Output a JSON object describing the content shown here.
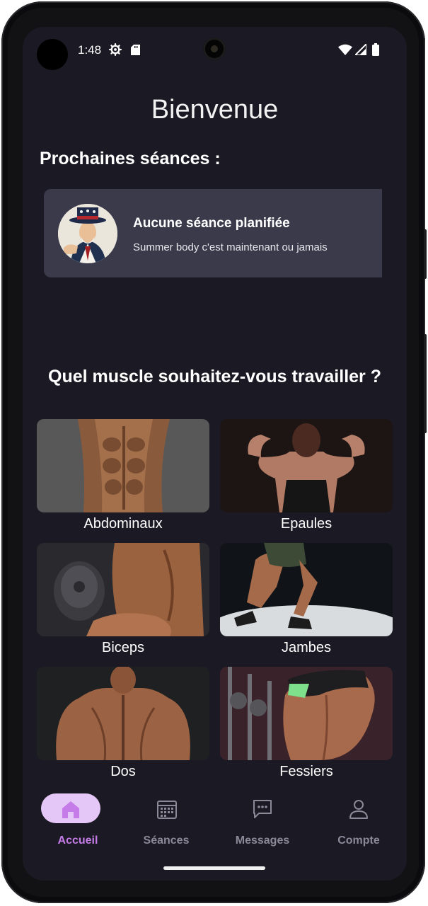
{
  "status_bar": {
    "time": "1:48"
  },
  "page_title": "Bienvenue",
  "upcoming": {
    "section_title": "Prochaines séances :",
    "card": {
      "title": "Aucune séance planifiée",
      "subtitle": "Summer body c'est maintenant ou jamais"
    }
  },
  "muscles": {
    "title": "Quel muscle souhaitez-vous travailler ?",
    "items": [
      {
        "label": "Abdominaux"
      },
      {
        "label": "Epaules"
      },
      {
        "label": "Biceps"
      },
      {
        "label": "Jambes"
      },
      {
        "label": "Dos"
      },
      {
        "label": "Fessiers"
      }
    ]
  },
  "nav": {
    "items": [
      {
        "label": "Accueil",
        "icon": "home-icon",
        "active": true
      },
      {
        "label": "Séances",
        "icon": "calendar-icon",
        "active": false
      },
      {
        "label": "Messages",
        "icon": "chat-icon",
        "active": false
      },
      {
        "label": "Compte",
        "icon": "person-icon",
        "active": false
      }
    ]
  },
  "colors": {
    "background": "#1b1a24",
    "card": "#3a3a4a",
    "accent": "#c67ce8",
    "active_pill": "#e4c6f7",
    "inactive_nav": "#8b8898"
  }
}
